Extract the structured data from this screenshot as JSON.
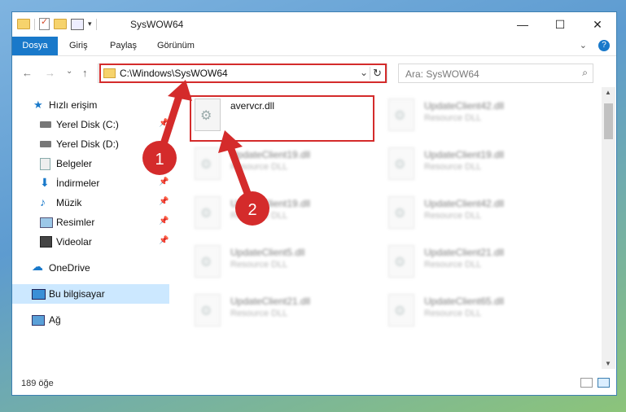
{
  "window": {
    "title": "SysWOW64",
    "controls": {
      "minimize": "—",
      "maximize": "☐",
      "close": "✕"
    }
  },
  "ribbon": {
    "tabs": [
      "Dosya",
      "Giriş",
      "Paylaş",
      "Görünüm"
    ],
    "help": "?",
    "expand": "⌄"
  },
  "nav": {
    "back": "←",
    "forward": "→",
    "recent": "⌄",
    "up": "↑",
    "address": "C:\\Windows\\SysWOW64",
    "dropdown": "⌄",
    "refresh": "↻",
    "search_placeholder": "Ara: SysWOW64",
    "search_icon": "⌕"
  },
  "sidebar": {
    "items": [
      {
        "label": "Hızlı erişim",
        "icon": "star-icon",
        "pinned": false
      },
      {
        "label": "Yerel Disk (C:)",
        "icon": "drive-icon",
        "pinned": true
      },
      {
        "label": "Yerel Disk (D:)",
        "icon": "drive-icon",
        "pinned": false
      },
      {
        "label": "Belgeler",
        "icon": "documents-icon",
        "pinned": true
      },
      {
        "label": "İndirmeler",
        "icon": "download-icon",
        "pinned": true
      },
      {
        "label": "Müzik",
        "icon": "music-icon",
        "pinned": true
      },
      {
        "label": "Resimler",
        "icon": "pictures-icon",
        "pinned": true
      },
      {
        "label": "Videolar",
        "icon": "videos-icon",
        "pinned": true
      },
      {
        "label": "OneDrive",
        "icon": "cloud-icon",
        "pinned": false
      },
      {
        "label": "Bu bilgisayar",
        "icon": "computer-icon",
        "pinned": false
      },
      {
        "label": "Ağ",
        "icon": "network-icon",
        "pinned": false
      }
    ],
    "pin_glyph": "📌"
  },
  "files": {
    "highlighted": {
      "name": "avervcr.dll"
    },
    "blurred": [
      {
        "name": "UpdateClient42.dll",
        "type": "Resource DLL"
      },
      {
        "name": "UpdateClient19.dll",
        "type": "Resource DLL"
      },
      {
        "name": "UpdateClient19.dll",
        "type": "Resource DLL"
      },
      {
        "name": "UpdateClient19.dll",
        "type": "Resource DLL"
      },
      {
        "name": "UpdateClient42.dll",
        "type": "Resource DLL"
      },
      {
        "name": "UpdateClient5.dll",
        "type": "Resource DLL"
      },
      {
        "name": "UpdateClient21.dll",
        "type": "Resource DLL"
      },
      {
        "name": "UpdateClient21.dll",
        "type": "Resource DLL"
      },
      {
        "name": "UpdateClient65.dll",
        "type": "Resource DLL"
      }
    ]
  },
  "status": {
    "count": "189 öğe"
  },
  "annotations": {
    "step1": "1",
    "step2": "2",
    "color": "#d42b2b"
  }
}
